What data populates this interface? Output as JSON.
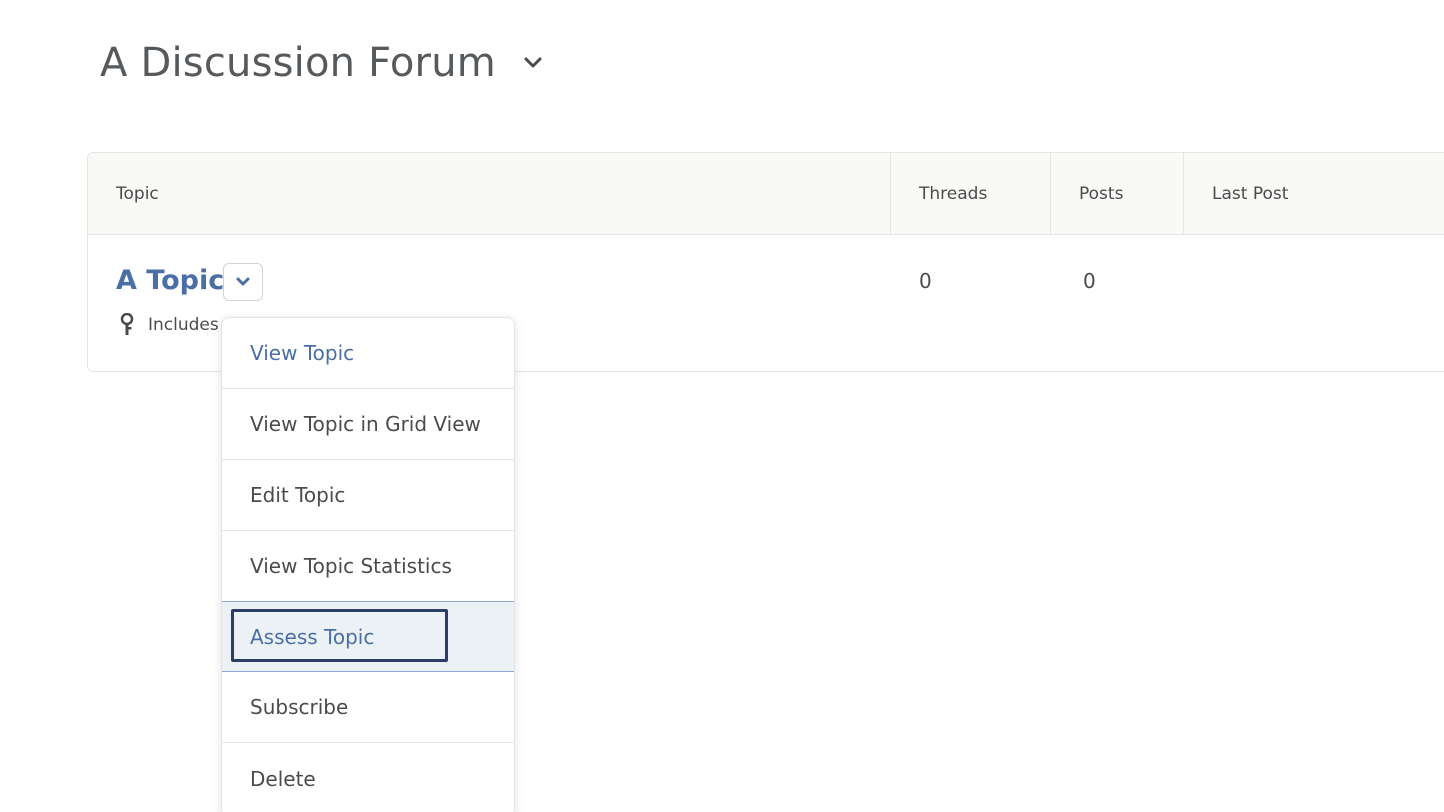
{
  "forum": {
    "title": "A Discussion Forum"
  },
  "table": {
    "headers": {
      "topic": "Topic",
      "threads": "Threads",
      "posts": "Posts",
      "last_post": "Last Post"
    },
    "rows": [
      {
        "topic": "A Topic",
        "includes_text": "Includes",
        "threads": "0",
        "posts": "0",
        "last_post": ""
      }
    ]
  },
  "dropdown": {
    "items": [
      "View Topic",
      "View Topic in Grid View",
      "Edit Topic",
      "View Topic Statistics",
      "Assess Topic",
      "Subscribe",
      "Delete"
    ],
    "highlighted_item": "Assess Topic"
  },
  "colors": {
    "link": "#4a6fa5",
    "text": "#494c4e",
    "header_bg": "#f9f9f6",
    "focus_outline": "#2c3d66",
    "active_bg": "#ecf1f5"
  },
  "icons": {
    "title_menu": "chevron-down-icon",
    "topic_menu": "chevron-down-icon",
    "includes": "pin-icon"
  }
}
